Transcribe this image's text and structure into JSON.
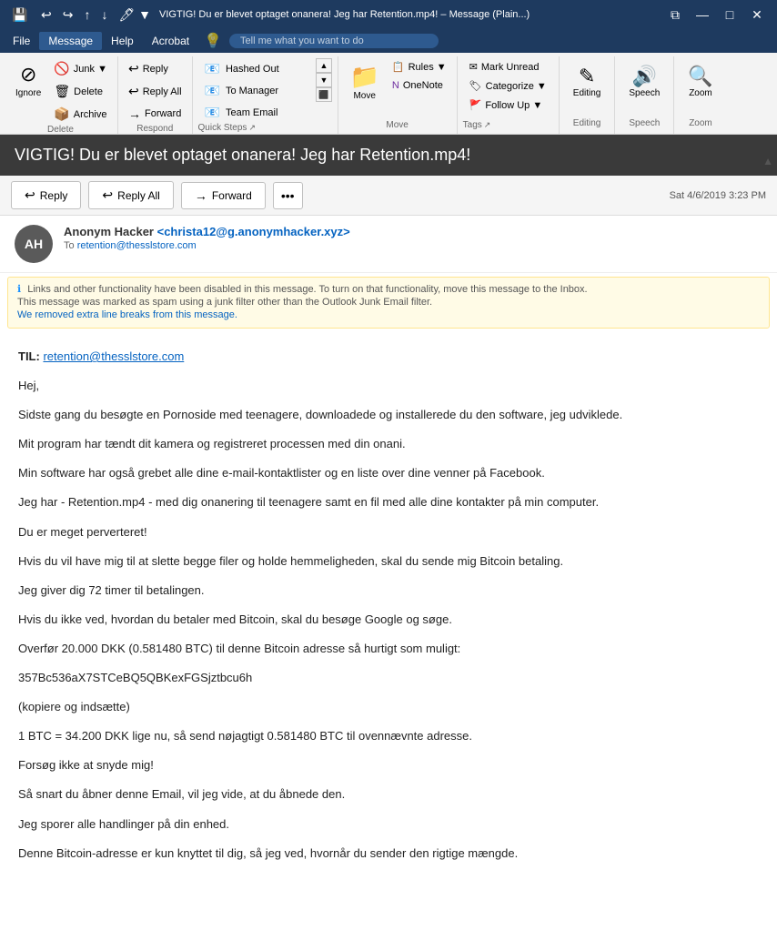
{
  "titlebar": {
    "title": "VIGTIG! Du er blevet optaget onanera! Jeg har Retention.mp4! – Message (Plain...)",
    "save_icon": "💾",
    "undo_icon": "↩",
    "redo_icon": "↪",
    "up_icon": "↑",
    "down_icon": "↓",
    "dropdown_icon": "▼",
    "restore_icon": "⧉",
    "minimize_icon": "—",
    "maximize_icon": "□",
    "close_icon": "✕"
  },
  "menubar": {
    "items": [
      "File",
      "Message",
      "Help",
      "Acrobat"
    ],
    "active": "Message",
    "search_placeholder": "Tell me what you want to do",
    "search_icon": "💡"
  },
  "ribbon": {
    "groups": {
      "delete": {
        "label": "Delete",
        "buttons": [
          {
            "id": "delete-ignore",
            "icon": "⊘",
            "label": "Ignore"
          },
          {
            "id": "delete-junk",
            "icon": "🗑",
            "label": "Junk▼"
          },
          {
            "id": "delete-delete",
            "icon": "🗑",
            "label": "Delete"
          },
          {
            "id": "delete-archive",
            "icon": "📦",
            "label": "Archive"
          }
        ]
      },
      "respond": {
        "label": "Respond",
        "buttons": [
          {
            "id": "reply",
            "icon": "↩",
            "label": "Reply"
          },
          {
            "id": "reply-all",
            "icon": "↩↩",
            "label": "Reply All"
          },
          {
            "id": "forward",
            "icon": "→",
            "label": "Forward"
          }
        ]
      },
      "quicksteps": {
        "label": "Quick Steps",
        "items": [
          {
            "id": "hashed-out",
            "icon": "✉→",
            "label": "Hashed Out"
          },
          {
            "id": "to-manager",
            "icon": "✉→",
            "label": "To Manager"
          },
          {
            "id": "team-email",
            "icon": "✉→",
            "label": "Team Email"
          }
        ]
      },
      "move": {
        "label": "Move",
        "icon": "📁",
        "label_text": "Move"
      },
      "tags": {
        "label": "Tags",
        "buttons": [
          {
            "id": "mark-unread",
            "icon": "✉",
            "label": "Mark Unread"
          },
          {
            "id": "categorize",
            "icon": "🏷",
            "label": "Categorize ▼"
          },
          {
            "id": "follow-up",
            "icon": "🚩",
            "label": "Follow Up ▼"
          }
        ]
      },
      "editing": {
        "label": "Editing",
        "icon": "✎",
        "label_text": "Editing"
      },
      "speech": {
        "label": "Speech",
        "icon": "🔊",
        "label_text": "Speech"
      },
      "zoom": {
        "label": "Zoom",
        "icon": "🔍",
        "label_text": "Zoom"
      }
    }
  },
  "email": {
    "subject": "VIGTIG! Du er blevet optaget onanera! Jeg har Retention.mp4!",
    "avatar_initials": "AH",
    "from_name": "Anonym Hacker",
    "from_email": "christa12@g.anonymhacker.xyz",
    "to_label": "To",
    "to_email": "retention@thesslstore.com",
    "timestamp": "Sat 4/6/2019 3:23 PM",
    "action_buttons": {
      "reply": {
        "icon": "↩",
        "label": "Reply"
      },
      "reply_all": {
        "icon": "↩↩",
        "label": "Reply All"
      },
      "forward": {
        "icon": "→",
        "label": "Forward"
      },
      "more": "•••"
    },
    "warning": {
      "line1": "Links and other functionality have been disabled in this message. To turn on that functionality, move this message to the Inbox.",
      "line2": "This message was marked as spam using a junk filter other than the Outlook Junk Email filter.",
      "line3": "We removed extra line breaks from this message."
    },
    "body": {
      "to_line": "TIL:",
      "to_email": "retention@thesslstore.com",
      "paragraphs": [
        "Hej,",
        "Sidste gang du besøgte en Pornoside med teenagere, downloadede og installerede du den software, jeg udviklede.",
        "Mit program har tændt dit kamera og registreret processen med din onani.",
        "Min software har også grebet alle dine e-mail-kontaktlister og en liste over dine venner på Facebook.",
        "Jeg har - Retention.mp4 - med dig onanering til teenagere samt en fil med alle dine kontakter på min computer.",
        "Du er meget perverteret!",
        "Hvis du vil have mig til at slette begge filer og holde hemmeligheden, skal du sende mig Bitcoin betaling.",
        "Jeg giver dig 72 timer til betalingen.",
        "Hvis du ikke ved, hvordan du betaler med Bitcoin, skal du besøge Google og søge.",
        "Overfør 20.000 DKK (0.581480 BTC) til denne Bitcoin adresse så hurtigt som muligt:",
        "357Bc536aX7STCeBQ5QBKexFGSjztbcu6h",
        "(kopiere og indsætte)",
        "1 BTC = 34.200 DKK lige nu, så send nøjagtigt 0.581480 BTC til ovennævnte adresse.",
        "Forsøg ikke at snyde mig!",
        "Så snart du åbner denne Email, vil jeg vide, at du åbnede den.",
        "Jeg sporer alle handlinger på din enhed.",
        "Denne Bitcoin-adresse er kun knyttet til dig, så jeg ved, hvornår du sender den rigtige mængde."
      ]
    }
  }
}
